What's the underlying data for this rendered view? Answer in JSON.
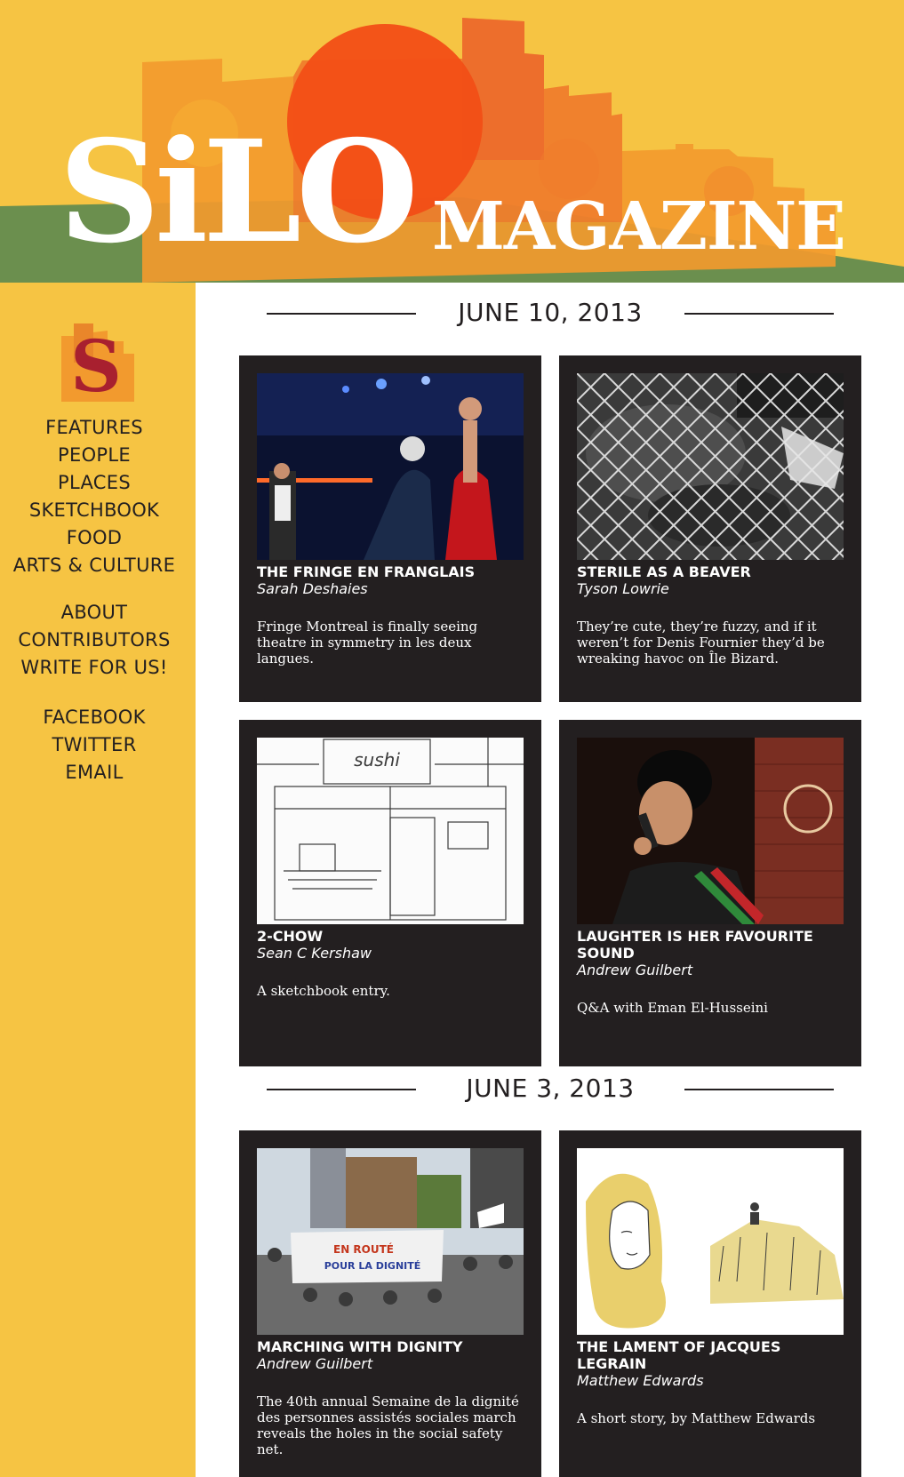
{
  "banner": {
    "logo_main": "SiLO",
    "logo_sub": "MAGAZINE"
  },
  "sidebar": {
    "logo_letter": "S",
    "sections": [
      "FEATURES",
      "PEOPLE",
      "PLACES",
      "SKETCHBOOK",
      "FOOD",
      "ARTS & CULTURE"
    ],
    "about_links": [
      "ABOUT",
      "CONTRIBUTORS",
      "WRITE FOR US!"
    ],
    "social_links": [
      "FACEBOOK",
      "TWITTER",
      "EMAIL"
    ]
  },
  "colors": {
    "sidebar_bg": "#f6c443",
    "card_bg": "#231f20",
    "banner_green": "#6b8f4e",
    "banner_red_orange": "#f05a1e"
  },
  "issues": [
    {
      "date": "JUNE 10, 2013",
      "articles": [
        {
          "title": "THE FRINGE EN FRANGLAIS",
          "author": "Sarah Deshaies",
          "excerpt": "Fringe Montreal is finally seeing theatre in symmetry in les deux langues.",
          "image": "stage-performers-photo"
        },
        {
          "title": "STERILE AS A BEAVER",
          "author": "Tyson Lowrie",
          "excerpt": "They’re cute, they’re fuzzy, and if it weren’t for Denis Fournier they’d be wreaking havoc on Île Bizard.",
          "image": "caged-beaver-photo"
        },
        {
          "title": "2-CHOW",
          "author": "Sean C Kershaw",
          "excerpt": "A sketchbook entry.",
          "image": "sushi-storefront-sketch"
        },
        {
          "title": "LAUGHTER IS HER FAVOURITE SOUND",
          "author": "Andrew Guilbert",
          "excerpt": "Q&A with Eman El-Husseini",
          "image": "comedian-microphone-photo"
        }
      ]
    },
    {
      "date": "JUNE 3, 2013",
      "articles": [
        {
          "title": "MARCHING WITH DIGNITY",
          "author": "Andrew Guilbert",
          "excerpt": "The 40th annual Semaine de la dignité des personnes assistés sociales march reveals the holes in the social safety net.",
          "image": "street-march-photo"
        },
        {
          "title": "THE LAMENT OF JACQUES LEGRAIN",
          "author": "Matthew Edwards",
          "excerpt": "A short story, by Matthew Edwards",
          "image": "wheatfield-illustration"
        }
      ]
    }
  ]
}
